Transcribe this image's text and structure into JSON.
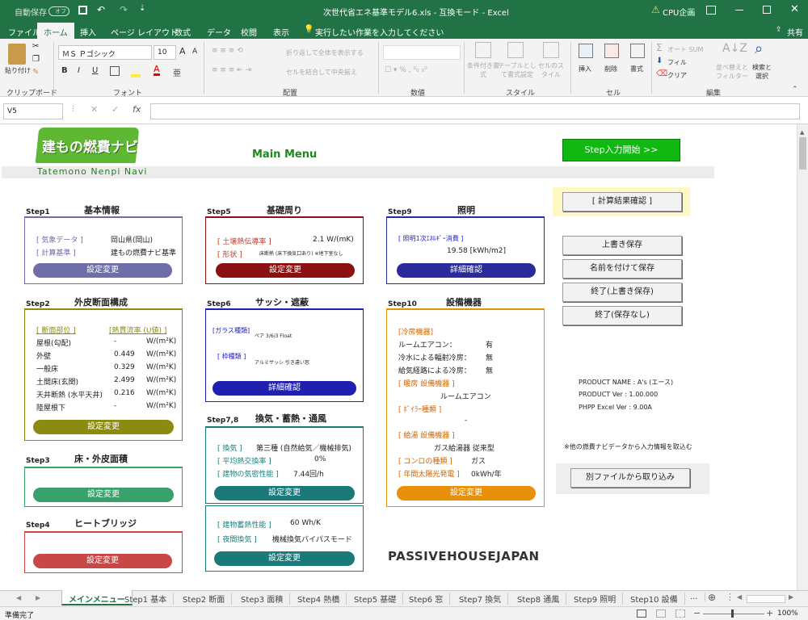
{
  "titlebar": {
    "autosave": "自動保存",
    "autosave_state": "オフ",
    "filename": "次世代省エネ基準モデル6.xls - 互換モード - Excel",
    "account": "CPU企画",
    "warning_icon": "warning-icon"
  },
  "menu": [
    "ファイル",
    "ホーム",
    "挿入",
    "ページ レイアウト",
    "数式",
    "データ",
    "校閲",
    "表示"
  ],
  "tell_me": "実行したい作業を入力してください",
  "share": "共有",
  "ribbon": {
    "paste": "貼り付け",
    "clipboard": "クリップボード",
    "font_name": "ＭＳ Ｐゴシック",
    "font_size": "10",
    "font_group": "フォント",
    "wrap": "折り返して全体を表示する",
    "merge": "セルを結合して中央揃え",
    "align_group": "配置",
    "number_group": "数値",
    "cond_format": "条件付き書式",
    "table_format": "テーブルとして書式設定",
    "cell_style": "セルのスタイル",
    "style_group": "スタイル",
    "insert": "挿入",
    "delete": "削除",
    "format": "書式",
    "cells_group": "セル",
    "autosum": "オート SUM",
    "fill": "フィル",
    "clear": "クリア",
    "sort": "並べ替えとフィルター",
    "find": "検索と選択",
    "edit_group": "編集"
  },
  "formula": {
    "cell_ref": "V5",
    "fx": "fx",
    "value": ""
  },
  "logo": {
    "main": "建もの燃費ナビ",
    "sub": "Tatemono Nenpi Navi"
  },
  "main_title": "Main Menu",
  "step_start": "Step入力開始 >>",
  "calc_check": "[ 計算結果確認 ]",
  "right_buttons": [
    "上書き保存",
    "名前を付けて保存",
    "終了(上書き保存)",
    "終了(保存なし)"
  ],
  "product": {
    "name": "PRODUCT NAME  :  A's (エース)",
    "ver": "PRODUCT Ver    :  1.00.000",
    "phpp": "PHPP Excel Ver :  9.00A"
  },
  "import_note": "※他の燃費ナビデータから入力情報を取込む",
  "import_button": "別ファイルから取り込み",
  "phj": "PASSIVEHOUSEJAPAN",
  "steps": {
    "s1": {
      "step": "Step1",
      "title": "基本情報",
      "rows": [
        [
          "[ 気象データ ]",
          "岡山県(岡山)"
        ],
        [
          "[ 計算基準 ]",
          "建もの燃費ナビ基準"
        ]
      ],
      "button": "設定変更"
    },
    "s2": {
      "step": "Step2",
      "title": "外皮断面構成",
      "h1": "[ 断面部位 ]",
      "h2": "[熱貫流率 (U値) ]",
      "rows": [
        [
          "屋根(勾配)",
          "-",
          "W/(m²K)"
        ],
        [
          "外壁",
          "0.449",
          "W/(m²K)"
        ],
        [
          "一般床",
          "0.329",
          "W/(m²K)"
        ],
        [
          "土間床(玄関)",
          "2.499",
          "W/(m²K)"
        ],
        [
          "天井断熱 (水平天井)",
          "0.216",
          "W/(m²K)"
        ],
        [
          "陸屋根下",
          "-",
          "W/(m²K)"
        ]
      ],
      "button": "設定変更"
    },
    "s3": {
      "step": "Step3",
      "title": "床・外皮面積",
      "button": "設定変更"
    },
    "s4": {
      "step": "Step4",
      "title": "ヒートブリッジ",
      "button": "設定変更"
    },
    "s5": {
      "step": "Step5",
      "title": "基礎周り",
      "rows": [
        [
          "[ 土壌熱伝導率 ]",
          "2.1 W/(mK)"
        ],
        [
          "[ 形状 ]",
          "床断熱 (床下換気口あり)  ※地下室なし"
        ]
      ],
      "button": "設定変更"
    },
    "s6": {
      "step": "Step6",
      "title": "サッシ・遮蔽",
      "rows": [
        [
          "[ガラス種類]",
          "ペア 3/6/3  Float"
        ],
        [
          "[ 枠種類 ]",
          "アルミサッシ 引き違い窓"
        ]
      ],
      "button": "詳細確認"
    },
    "s78": {
      "step": "Step7,8",
      "title": "換気・蓄熱・通風",
      "rows": [
        [
          "[ 換気 ]",
          "第三種 (自然給気／機械排気)"
        ],
        [
          "[ 平均熱交換率 ]",
          "0%"
        ],
        [
          "[ 建物の気密性能 ]",
          "7.44回/h"
        ]
      ],
      "button": "設定変更",
      "rows2": [
        [
          "[ 建物蓄熱性能 ]",
          "60 Wh/K"
        ],
        [
          "[ 夜間換気 ]",
          "機械換気バイパスモード"
        ]
      ],
      "button2": "設定変更"
    },
    "s9": {
      "step": "Step9",
      "title": "照明",
      "label": "[ 照明1次ｴﾈﾙｷﾞｰ消費 ]",
      "value": "19.58  [kWh/m2]",
      "button": "詳細確認"
    },
    "s10": {
      "step": "Step10",
      "title": "設備機器",
      "cool": "[冷房機器]",
      "rows": [
        [
          "ルームエアコン：",
          "有"
        ],
        [
          "冷水による輻射冷房：",
          "無"
        ],
        [
          "給気経路による冷房：",
          "無"
        ]
      ],
      "heat": "[ 暖房 設備機器 ]",
      "heat_v": "ルームエアコン",
      "boiler": "[ ﾎﾞｲﾗｰ種類 ]",
      "boiler_v": "-",
      "hot": "[ 給湯 設備機器 ]",
      "hot_v": "ガス給湯器 従来型",
      "stove": "[ コンロの種類 ]",
      "stove_v": "ガス",
      "solar": "[ 年間太陽光発電 ]",
      "solar_v": "0kWh/年",
      "button": "設定変更"
    }
  },
  "sheet_tabs": [
    "メインメニュー",
    "Step1 基本",
    "Step2 断面",
    "Step3 面積",
    "Step4 熱橋",
    "Step5 基礎",
    "Step6 窓",
    "Step7 換気",
    "Step8 通風",
    "Step9 照明",
    "Step10 設備",
    "..."
  ],
  "status": {
    "ready": "準備完了",
    "zoom": "100%"
  },
  "colors": {
    "excel_green": "#217346",
    "s1": "#6e6ea8",
    "s2": "#8b8b12",
    "s3": "#3aa06c",
    "s4": "#c84848",
    "s5": "#8b1010",
    "s6": "#2020b0",
    "s78": "#1a7a7a",
    "s9": "#2a2a9a",
    "s10": "#e8900a",
    "start_btn": "#12b812"
  }
}
